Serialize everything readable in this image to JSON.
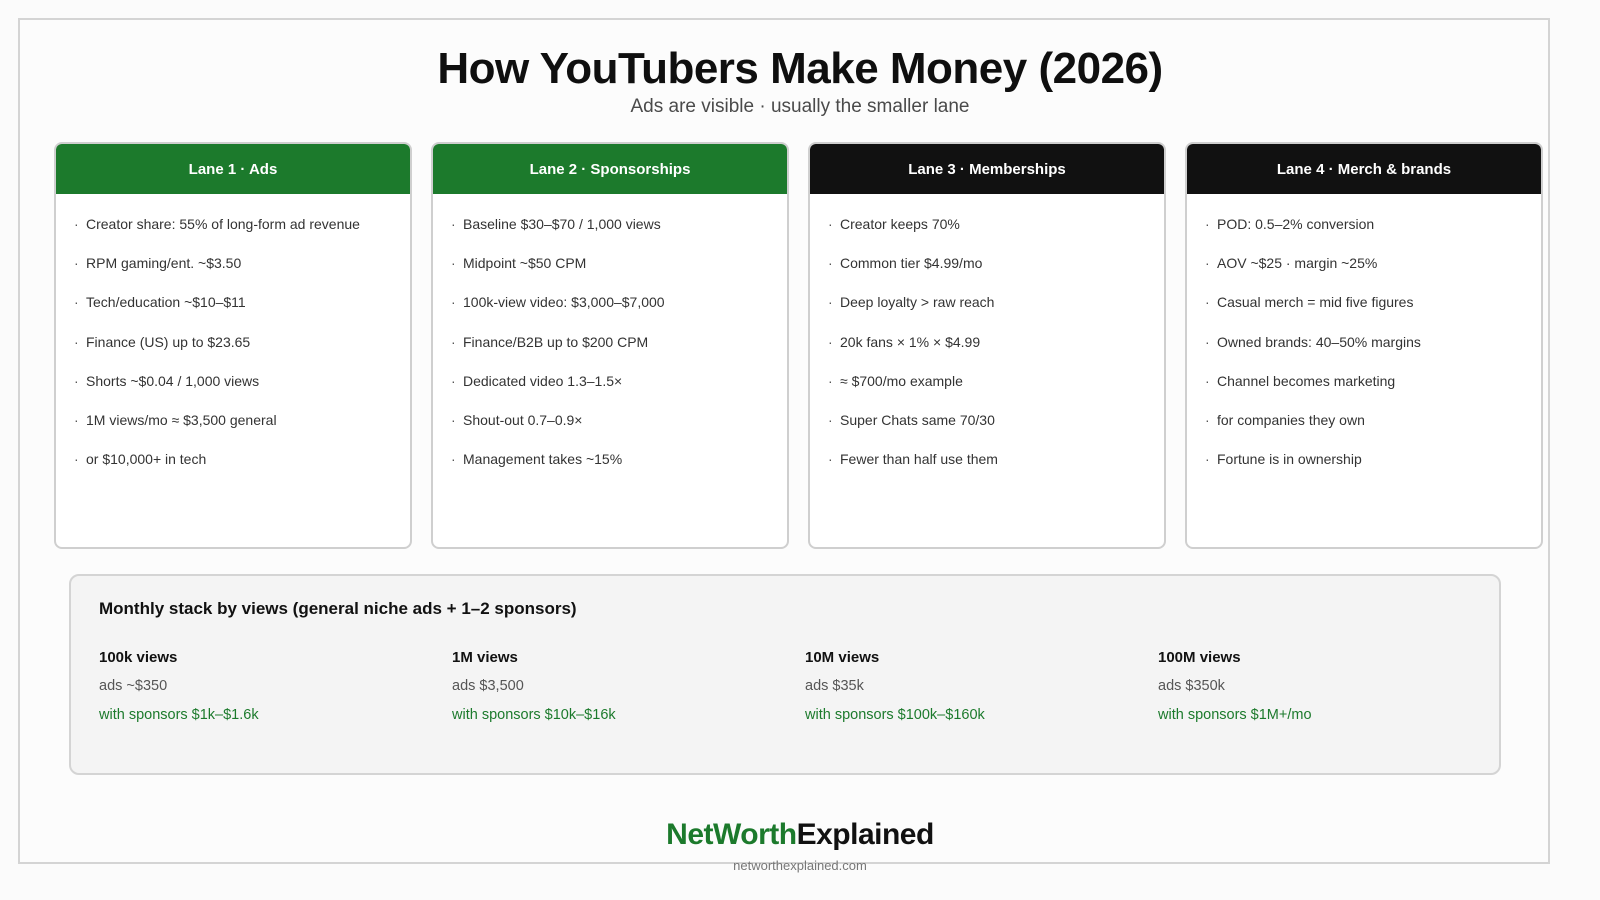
{
  "header": {
    "title": "How YouTubers Make Money (2026)",
    "subtitle": "Ads are visible · usually the smaller lane"
  },
  "colors": {
    "accent_green": "#1c7a2c",
    "header_dark": "#111111"
  },
  "lanes": [
    {
      "title": "Lane 1 · Ads",
      "style": "green",
      "items": [
        "Creator share: 55% of long-form ad revenue",
        "RPM gaming/ent. ~$3.50",
        "Tech/education ~$10–$11",
        "Finance (US) up to $23.65",
        "Shorts ~$0.04 / 1,000 views",
        "1M views/mo ≈ $3,500 general",
        "or $10,000+ in tech"
      ]
    },
    {
      "title": "Lane 2 · Sponsorships",
      "style": "green",
      "items": [
        "Baseline $30–$70 / 1,000 views",
        "Midpoint ~$50 CPM",
        "100k-view video: $3,000–$7,000",
        "Finance/B2B up to $200 CPM",
        "Dedicated video 1.3–1.5×",
        "Shout-out 0.7–0.9×",
        "Management takes ~15%"
      ]
    },
    {
      "title": "Lane 3 · Memberships",
      "style": "dark",
      "items": [
        "Creator keeps 70%",
        "Common tier $4.99/mo",
        "Deep loyalty > raw reach",
        "20k fans × 1% × $4.99",
        "≈ $700/mo example",
        "Super Chats same 70/30",
        "Fewer than half use them"
      ]
    },
    {
      "title": "Lane 4 · Merch & brands",
      "style": "dark",
      "items": [
        "POD: 0.5–2% conversion",
        "AOV ~$25 · margin ~25%",
        "Casual merch = mid five figures",
        "Owned brands: 40–50% margins",
        "Channel becomes marketing",
        "for companies they own",
        "Fortune is in ownership"
      ]
    }
  ],
  "stack": {
    "title": "Monthly stack by views (general niche ads + 1–2 sponsors)",
    "columns": [
      {
        "views": "100k views",
        "ads": "ads ~$350",
        "sponsors": "with sponsors $1k–$1.6k"
      },
      {
        "views": "1M views",
        "ads": "ads $3,500",
        "sponsors": "with sponsors $10k–$16k"
      },
      {
        "views": "10M views",
        "ads": "ads $35k",
        "sponsors": "with sponsors $100k–$160k"
      },
      {
        "views": "100M views",
        "ads": "ads $350k",
        "sponsors": "with sponsors $1M+/mo"
      }
    ]
  },
  "footer": {
    "brand_part1": "NetWorth",
    "brand_part2": "Explained",
    "url": "networthexplained.com"
  }
}
